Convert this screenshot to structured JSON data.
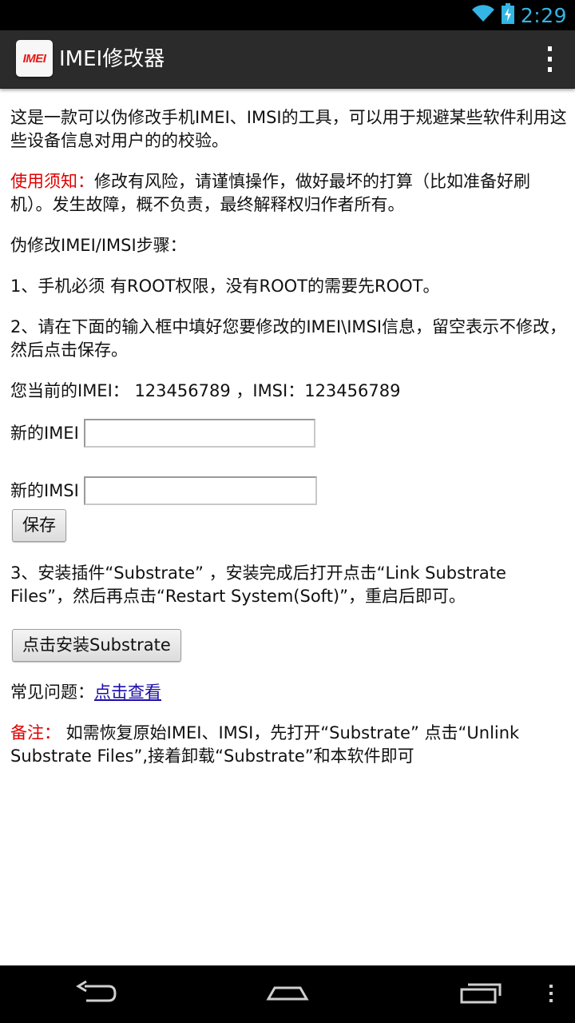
{
  "status_bar": {
    "time": "2:29",
    "icons": [
      "wifi-icon",
      "battery-charging-icon"
    ]
  },
  "action_bar": {
    "app_icon_text": "IMEI",
    "title": "IMEI修改器",
    "overflow_icon": "overflow-menu-icon"
  },
  "content": {
    "intro": "这是一款可以伪修改手机IMEI、IMSI的工具，可以用于规避某些软件利用这些设备信息对用户的的校验。",
    "notice_label": "使用须知：",
    "notice_text": "修改有风险，请谨慎操作，做好最坏的打算（比如准备好刷机）。发生故障，概不负责，最终解释权归作者所有。",
    "steps_title": "伪修改IMEI/IMSI步骤：",
    "step1": "1、手机必须 有ROOT权限，没有ROOT的需要先ROOT。",
    "step2": "2、请在下面的输入框中填好您要修改的IMEI\\IMSI信息，留空表示不修改，然后点击保存。",
    "current_info": "您当前的IMEI： 123456789 ，IMSI：123456789",
    "new_imei_label": "新的IMEI",
    "new_imei_value": "",
    "new_imsi_label": "新的IMSI",
    "new_imsi_value": "",
    "save_button": "保存",
    "step3": "3、安装插件“Substrate” ，安装完成后打开点击“Link Substrate Files”，然后再点击“Restart System(Soft)”，重启后即可。",
    "install_button": "点击安装Substrate",
    "faq_label": "常见问题：",
    "faq_link": "点击查看",
    "remark_label": "备注：",
    "remark_text": " 如需恢复原始IMEI、IMSI，先打开“Substrate” 点击“Unlink Substrate Files”,接着卸载“Substrate”和本软件即可"
  },
  "nav_bar": {
    "icons": [
      "back-icon",
      "home-icon",
      "recent-apps-icon",
      "menu-icon"
    ]
  },
  "colors": {
    "status_time": "#33b5e5",
    "action_bar": "#2b2b2b",
    "warning_red": "#e00000",
    "link": "#1a0dab"
  }
}
